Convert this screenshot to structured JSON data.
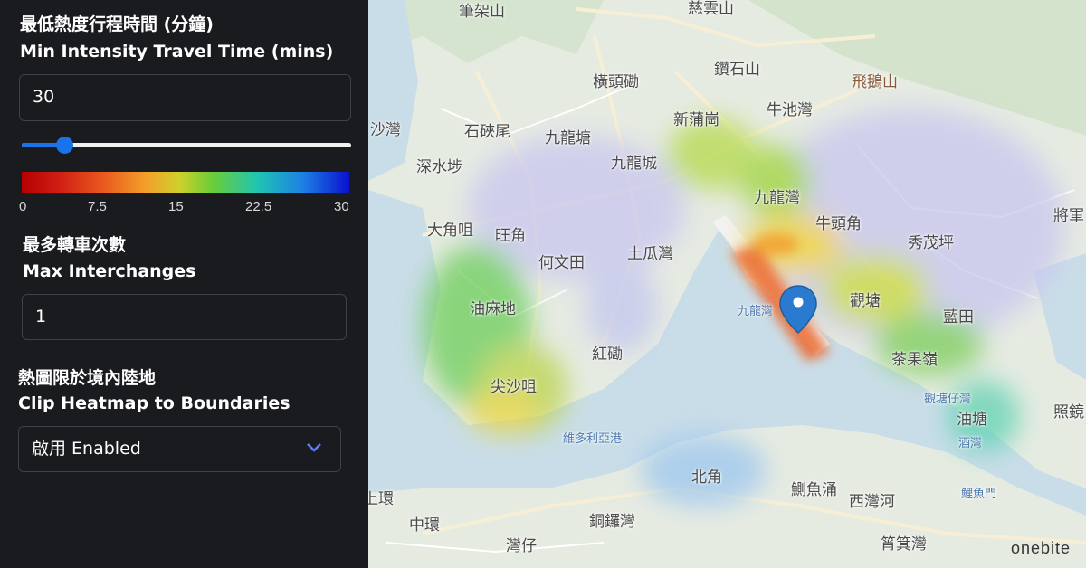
{
  "controls": {
    "travel_time": {
      "label_zh": "最低熱度行程時間 (分鐘)",
      "label_en": "Min Intensity Travel Time (mins)",
      "value": "30",
      "slider_value": 0.13
    },
    "legend": {
      "ticks": [
        "0",
        "7.5",
        "15",
        "22.5",
        "30"
      ]
    },
    "interchanges": {
      "label_zh": "最多轉車次數",
      "label_en": "Max Interchanges",
      "value": "1"
    },
    "clip": {
      "label_zh": "熱圖限於境內陸地",
      "label_en": "Clip Heatmap to Boundaries",
      "selected": "啟用 Enabled"
    }
  },
  "map": {
    "places": [
      {
        "text": "筆架山"
      },
      {
        "text": "慈雲山"
      },
      {
        "text": "橫頭磡"
      },
      {
        "text": "鑽石山"
      },
      {
        "text": "飛鵝山"
      },
      {
        "text": "沙灣"
      },
      {
        "text": "石硤尾"
      },
      {
        "text": "九龍塘"
      },
      {
        "text": "新蒲崗"
      },
      {
        "text": "牛池灣"
      },
      {
        "text": "深水埗"
      },
      {
        "text": "九龍城"
      },
      {
        "text": "九龍灣"
      },
      {
        "text": "大角咀"
      },
      {
        "text": "旺角"
      },
      {
        "text": "牛頭角"
      },
      {
        "text": "何文田"
      },
      {
        "text": "土瓜灣"
      },
      {
        "text": "秀茂坪"
      },
      {
        "text": "將軍"
      },
      {
        "text": "油麻地"
      },
      {
        "text": "九龍灣"
      },
      {
        "text": "觀塘"
      },
      {
        "text": "藍田"
      },
      {
        "text": "紅磡"
      },
      {
        "text": "茶果嶺"
      },
      {
        "text": "尖沙咀"
      },
      {
        "text": "觀塘仔灣"
      },
      {
        "text": "照鏡"
      },
      {
        "text": "油塘"
      },
      {
        "text": "維多利亞港"
      },
      {
        "text": "酒灣"
      },
      {
        "text": "北角"
      },
      {
        "text": "鰂魚涌"
      },
      {
        "text": "鯉魚門"
      },
      {
        "text": "上環"
      },
      {
        "text": "西灣河"
      },
      {
        "text": "中環"
      },
      {
        "text": "銅鑼灣"
      },
      {
        "text": "灣仔"
      },
      {
        "text": "筲箕灣"
      }
    ],
    "brand": "onebite"
  },
  "colors": {
    "panel_bg": "#1a1b1f",
    "accent": "#1a73e8",
    "marker": "#2a7bd0"
  }
}
